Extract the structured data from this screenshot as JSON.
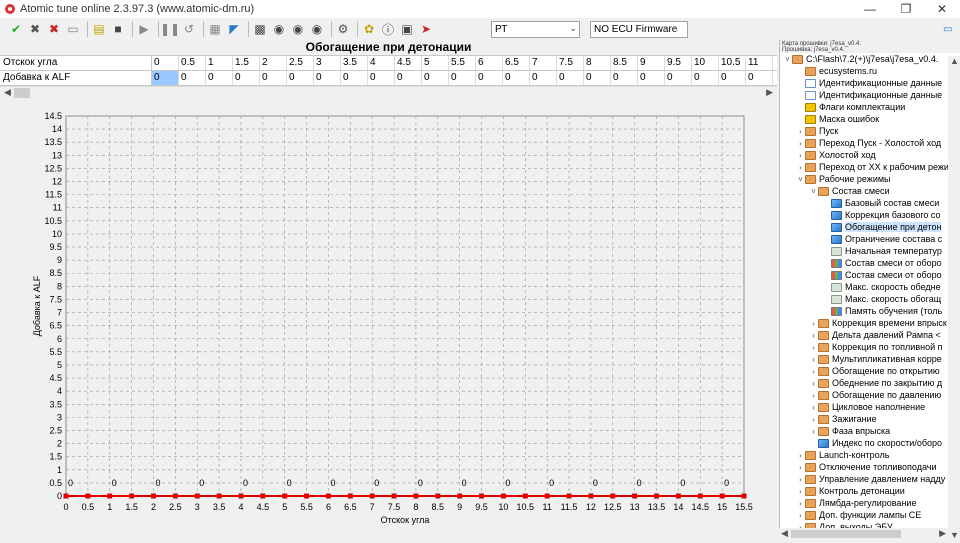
{
  "window": {
    "title": "Atomic tune online 2.3.97.3 (www.atomic-dm.ru)"
  },
  "toolbar": {
    "icons": [
      "check-icon",
      "cancel-icon",
      "delete-icon",
      "new-file-icon",
      "copy-icon",
      "stop-icon",
      "play-icon",
      "pause-icon",
      "undo-icon",
      "grid-icon",
      "chart-icon",
      "monitor-icon",
      "car-icon",
      "car2-icon",
      "car3-icon",
      "settings-icon",
      "tree-icon",
      "info-icon",
      "terminal-icon",
      "exit-icon"
    ],
    "combo_rt": "РТ",
    "firmware": "NO ECU Firmware"
  },
  "table": {
    "title": "Обогащение при детонации",
    "row1_label": "Отскок угла",
    "row2_label": "Добавка к ALF",
    "x_values": [
      "0",
      "0.5",
      "1",
      "1.5",
      "2",
      "2.5",
      "3",
      "3.5",
      "4",
      "4.5",
      "5",
      "5.5",
      "6",
      "6.5",
      "7",
      "7.5",
      "8",
      "8.5",
      "9",
      "9.5",
      "10",
      "10.5",
      "11"
    ],
    "y_values": [
      "0",
      "0",
      "0",
      "0",
      "0",
      "0",
      "0",
      "0",
      "0",
      "0",
      "0",
      "0",
      "0",
      "0",
      "0",
      "0",
      "0",
      "0",
      "0",
      "0",
      "0",
      "0",
      "0"
    ]
  },
  "chart_data": {
    "type": "line",
    "xlabel": "Отскок угла",
    "ylabel": "Добавка к ALF",
    "x": [
      0,
      0.5,
      1,
      1.5,
      2,
      2.5,
      3,
      3.5,
      4,
      4.5,
      5,
      5.5,
      6,
      6.5,
      7,
      7.5,
      8,
      8.5,
      9,
      9.5,
      10,
      10.5,
      11,
      11.5,
      12,
      12.5,
      13,
      13.5,
      14,
      14.5,
      15,
      15.5
    ],
    "series": [
      {
        "values": [
          0,
          0,
          0,
          0,
          0,
          0,
          0,
          0,
          0,
          0,
          0,
          0,
          0,
          0,
          0,
          0,
          0,
          0,
          0,
          0,
          0,
          0,
          0,
          0,
          0,
          0,
          0,
          0,
          0,
          0,
          0,
          0
        ],
        "color": "#e00000"
      }
    ],
    "point_labels": [
      "0",
      "0",
      "0",
      "0",
      "0",
      "0",
      "0",
      "0",
      "0",
      "0",
      "0",
      "0",
      "0",
      "0",
      "0",
      "0"
    ],
    "xlim": [
      0,
      15.5
    ],
    "ylim": [
      0,
      14.5
    ],
    "yticks": [
      "0",
      "0.5",
      "1",
      "1.5",
      "2",
      "2.5",
      "3",
      "3.5",
      "4",
      "4.5",
      "5",
      "5.5",
      "6",
      "6.5",
      "7",
      "7.5",
      "8",
      "8.5",
      "9",
      "9.5",
      "10",
      "10.5",
      "11",
      "11.5",
      "12",
      "12.5",
      "13",
      "13.5",
      "14",
      "14.5"
    ],
    "xticks": [
      "0",
      "0.5",
      "1",
      "1.5",
      "2",
      "2.5",
      "3",
      "3.5",
      "4",
      "4.5",
      "5",
      "5.5",
      "6",
      "6.5",
      "7",
      "7.5",
      "8",
      "8.5",
      "9",
      "9.5",
      "10",
      "10.5",
      "11",
      "11.5",
      "12",
      "12.5",
      "13",
      "13.5",
      "14",
      "14.5",
      "15",
      "15.5"
    ],
    "grid": true
  },
  "right_panel": {
    "header1": "Карта прошивки: j7esa_v0.4.",
    "header2": "Прошивка: j7esa_v0.4.",
    "tree": [
      {
        "label": "C:\\Flash\\7.2(+)\\j7esa\\j7esa_v0.4.",
        "icon": "folder",
        "depth": 0,
        "exp": "v"
      },
      {
        "label": "ecusystems.ru",
        "icon": "folder",
        "depth": 1,
        "exp": ""
      },
      {
        "label": "Идентификационные данные",
        "icon": "doc",
        "depth": 1,
        "exp": ""
      },
      {
        "label": "Идентификационные данные",
        "icon": "doc",
        "depth": 1,
        "exp": ""
      },
      {
        "label": "Флаги комплектации",
        "icon": "flag",
        "depth": 1,
        "exp": ""
      },
      {
        "label": "Маска ошибок",
        "icon": "flag",
        "depth": 1,
        "exp": ""
      },
      {
        "label": "Пуск",
        "icon": "folder",
        "depth": 1,
        "exp": ">"
      },
      {
        "label": "Переход Пуск - Холостой ход",
        "icon": "folder",
        "depth": 1,
        "exp": ">"
      },
      {
        "label": "Холостой ход",
        "icon": "folder",
        "depth": 1,
        "exp": ">"
      },
      {
        "label": "Переход от ХХ к рабочим режи",
        "icon": "folder",
        "depth": 1,
        "exp": ">"
      },
      {
        "label": "Рабочие режимы",
        "icon": "folder",
        "depth": 1,
        "exp": "v"
      },
      {
        "label": "Состав смеси",
        "icon": "folder",
        "depth": 2,
        "exp": "v"
      },
      {
        "label": "Базовый состав смеси",
        "icon": "chart2",
        "depth": 3,
        "exp": ""
      },
      {
        "label": "Коррекция базового со",
        "icon": "chart2",
        "depth": 3,
        "exp": ""
      },
      {
        "label": "Обогащение при детон",
        "icon": "chart2",
        "depth": 3,
        "exp": "",
        "selected": true
      },
      {
        "label": "Ограничение состава с",
        "icon": "chart2",
        "depth": 3,
        "exp": ""
      },
      {
        "label": "Начальная температур",
        "icon": "gray",
        "depth": 3,
        "exp": ""
      },
      {
        "label": "Состав смеси от оборо",
        "icon": "bars",
        "depth": 3,
        "exp": ""
      },
      {
        "label": "Состав смеси от оборо",
        "icon": "bars",
        "depth": 3,
        "exp": ""
      },
      {
        "label": "Макс. скорость обедне",
        "icon": "gray",
        "depth": 3,
        "exp": ""
      },
      {
        "label": "Макс. скорость обогащ",
        "icon": "gray",
        "depth": 3,
        "exp": ""
      },
      {
        "label": "Память обучения (толь",
        "icon": "bars",
        "depth": 3,
        "exp": ""
      },
      {
        "label": "Коррекция времени впрыск",
        "icon": "folder",
        "depth": 2,
        "exp": ">"
      },
      {
        "label": "Дельта давлений Рампа <",
        "icon": "folder",
        "depth": 2,
        "exp": ">"
      },
      {
        "label": "Коррекция по топливной п",
        "icon": "folder",
        "depth": 2,
        "exp": ">"
      },
      {
        "label": "Мультипликативная корре",
        "icon": "folder",
        "depth": 2,
        "exp": ">"
      },
      {
        "label": "Обогащение по открытию",
        "icon": "folder",
        "depth": 2,
        "exp": ">"
      },
      {
        "label": "Обеднение по закрытию д",
        "icon": "folder",
        "depth": 2,
        "exp": ">"
      },
      {
        "label": "Обогащение по давлению",
        "icon": "folder",
        "depth": 2,
        "exp": ">"
      },
      {
        "label": "Цикловое наполнение",
        "icon": "folder",
        "depth": 2,
        "exp": ">"
      },
      {
        "label": "Зажигание",
        "icon": "folder",
        "depth": 2,
        "exp": ">"
      },
      {
        "label": "Фаза впрыска",
        "icon": "folder",
        "depth": 2,
        "exp": ">"
      },
      {
        "label": "Индекс по скорости/оборо",
        "icon": "chart2",
        "depth": 2,
        "exp": ""
      },
      {
        "label": "Launch-контроль",
        "icon": "folder",
        "depth": 1,
        "exp": ">"
      },
      {
        "label": "Отключение топливоподачи",
        "icon": "folder",
        "depth": 1,
        "exp": ">"
      },
      {
        "label": "Управление давлением надду",
        "icon": "folder",
        "depth": 1,
        "exp": ">"
      },
      {
        "label": "Контроль детонации",
        "icon": "folder",
        "depth": 1,
        "exp": ">"
      },
      {
        "label": "Лямбда-регулирование",
        "icon": "folder",
        "depth": 1,
        "exp": ">"
      },
      {
        "label": "Доп. функции лампы CE",
        "icon": "folder",
        "depth": 1,
        "exp": ">"
      },
      {
        "label": "Доп. выходы ЭБУ",
        "icon": "folder",
        "depth": 1,
        "exp": ">"
      }
    ]
  }
}
